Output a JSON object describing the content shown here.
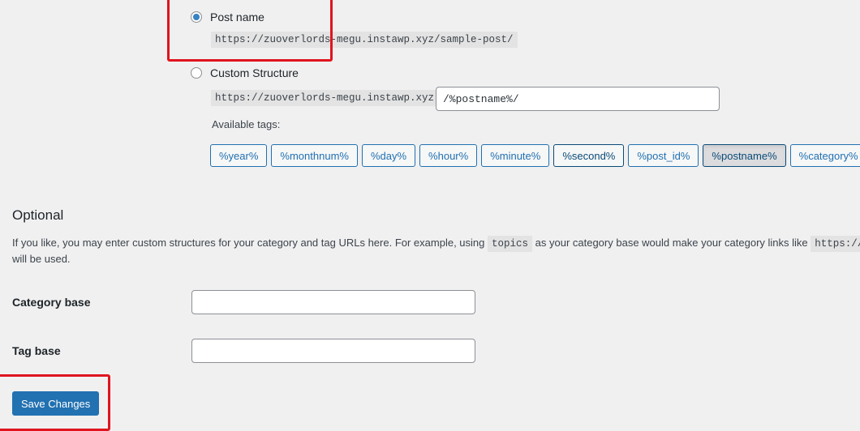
{
  "permalink": {
    "post_name": {
      "label": "Post name",
      "checked": true,
      "example": "https://zuoverlords-megu.instawp.xyz/sample-post/"
    },
    "custom_structure": {
      "label": "Custom Structure",
      "checked": false,
      "prefix": "https://zuoverlords-megu.instawp.xyz",
      "value": "/%postname%/"
    },
    "available_tags_label": "Available tags:",
    "tags": [
      {
        "label": "%year%",
        "state": "normal"
      },
      {
        "label": "%monthnum%",
        "state": "normal"
      },
      {
        "label": "%day%",
        "state": "normal"
      },
      {
        "label": "%hour%",
        "state": "normal"
      },
      {
        "label": "%minute%",
        "state": "normal"
      },
      {
        "label": "%second%",
        "state": "hover"
      },
      {
        "label": "%post_id%",
        "state": "normal"
      },
      {
        "label": "%postname%",
        "state": "active"
      },
      {
        "label": "%category%",
        "state": "normal"
      }
    ]
  },
  "optional": {
    "heading": "Optional",
    "description_before": "If you like, you may enter custom structures for your category and tag URLs here. For example, using",
    "description_code": "topics",
    "description_after": "as your category base would make your category links like",
    "description_code2": "https://z",
    "description_line2": "will be used.",
    "category_base": {
      "label": "Category base",
      "value": ""
    },
    "tag_base": {
      "label": "Tag base",
      "value": ""
    }
  },
  "actions": {
    "save_label": "Save Changes"
  },
  "colors": {
    "accent": "#2271b1",
    "highlight": "#e0141e",
    "background": "#f0f0f1"
  }
}
